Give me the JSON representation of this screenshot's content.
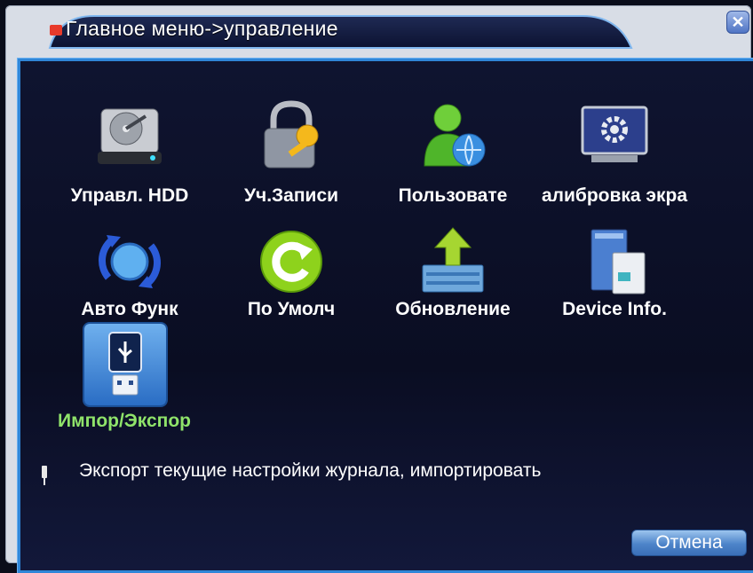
{
  "window": {
    "title": "Главное меню->управление",
    "close_symbol": "✕"
  },
  "menu": {
    "items": [
      {
        "label": "Управл. HDD",
        "icon": "hard-drive-icon",
        "active": false
      },
      {
        "label": "Уч.Записи",
        "icon": "padlock-key-icon",
        "active": false
      },
      {
        "label": "Пользовате",
        "icon": "user-globe-icon",
        "active": false
      },
      {
        "label": "алибровка экра",
        "icon": "monitor-gear-icon",
        "active": false
      },
      {
        "label": "Авто Функ",
        "icon": "auto-cycle-icon",
        "active": false
      },
      {
        "label": "По Умолч",
        "icon": "reset-default-icon",
        "active": false
      },
      {
        "label": "Обновление",
        "icon": "upgrade-arrow-icon",
        "active": false
      },
      {
        "label": "Device Info.",
        "icon": "device-info-icon",
        "active": false
      },
      {
        "label": "Импор/Экспор",
        "icon": "usb-drive-icon",
        "active": true
      }
    ]
  },
  "hint": {
    "text": "Экспорт текущие настройки журнала, импортировать"
  },
  "buttons": {
    "cancel_label": "Отмена"
  },
  "colors": {
    "panel_border": "#2f86d8",
    "active_label": "#8fe36a",
    "button": "#4d84c9"
  }
}
